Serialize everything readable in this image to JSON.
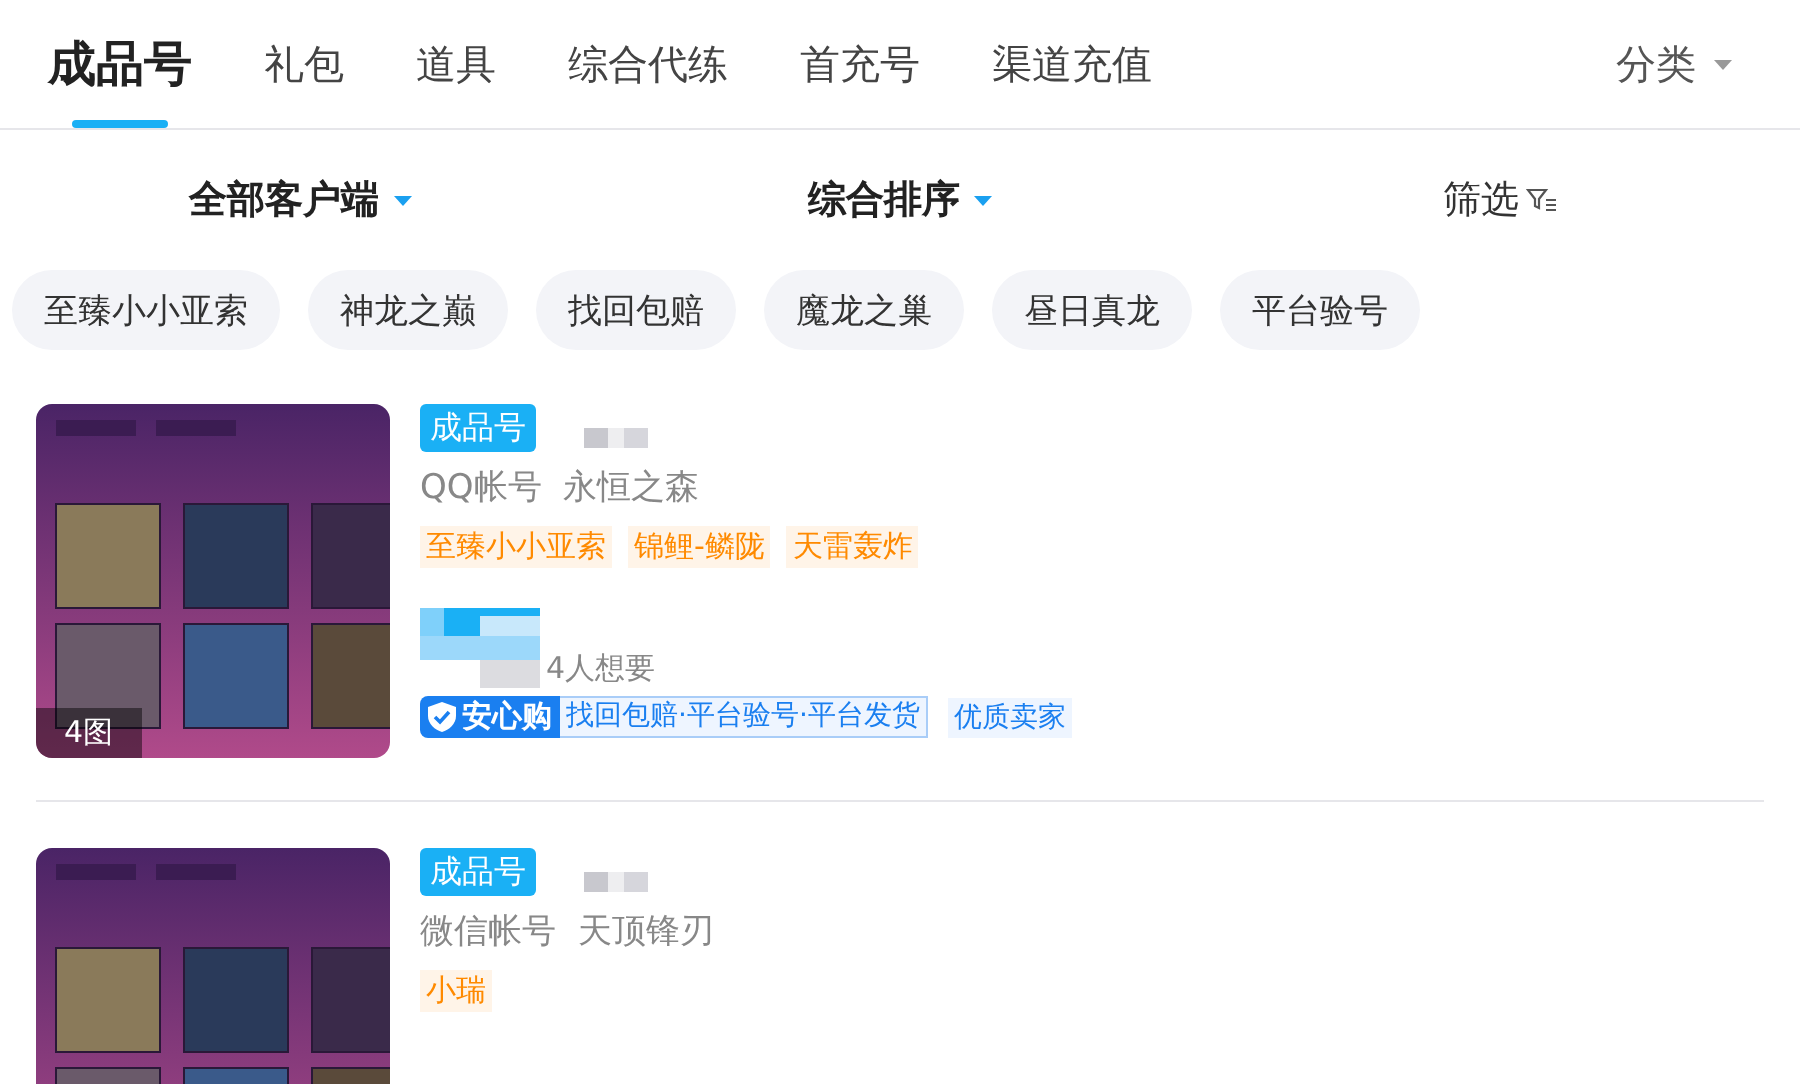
{
  "tabs": [
    {
      "label": "成品号",
      "selected": true
    },
    {
      "label": "礼包",
      "selected": false
    },
    {
      "label": "道具",
      "selected": false
    },
    {
      "label": "综合代练",
      "selected": false
    },
    {
      "label": "首充号",
      "selected": false
    },
    {
      "label": "渠道充值",
      "selected": false
    }
  ],
  "category": {
    "label": "分类"
  },
  "sort_bar": [
    {
      "label": "全部客户端",
      "kind": "dropdown"
    },
    {
      "label": "综合排序",
      "kind": "dropdown"
    },
    {
      "label": "筛选",
      "kind": "filter"
    }
  ],
  "chips": [
    "至臻小小亚索",
    "神龙之巅",
    "找回包赔",
    "魔龙之巢",
    "昼日真龙",
    "平台验号"
  ],
  "listings": [
    {
      "badge": "成品号",
      "account": "QQ帐号  永恒之森",
      "tags": [
        "至臻小小亚索",
        "锦鲤-鳞陇",
        "天雷轰炸"
      ],
      "image_count": "4图",
      "wants": "4人想要",
      "guarantee": {
        "brand": "安心购",
        "features": "找回包赔·平台验号·平台发货"
      },
      "seller_badge": "优质卖家"
    },
    {
      "badge": "成品号",
      "account": "微信帐号  天顶锋刃",
      "tags": [
        "小瑞"
      ]
    }
  ]
}
